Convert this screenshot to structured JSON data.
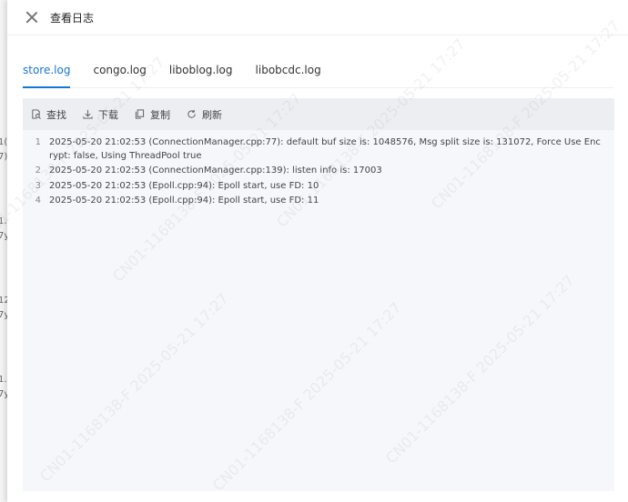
{
  "dialog": {
    "title": "查看日志"
  },
  "tabs": [
    {
      "label": "store.log",
      "active": true
    },
    {
      "label": "congo.log",
      "active": false
    },
    {
      "label": "liboblog.log",
      "active": false
    },
    {
      "label": "libobcdc.log",
      "active": false
    }
  ],
  "toolbar": {
    "find_label": "查找",
    "download_label": "下载",
    "copy_label": "复制",
    "refresh_label": "刷新"
  },
  "log": {
    "lines": [
      {
        "num": "1",
        "text": "2025-05-20 21:02:53 (ConnectionManager.cpp:77): default buf size is: 1048576, Msg split size is: 131072, Force Use Encrypt: false, Using ThreadPool true"
      },
      {
        "num": "2",
        "text": "2025-05-20 21:02:53 (ConnectionManager.cpp:139): listen info is: 17003"
      },
      {
        "num": "3",
        "text": "2025-05-20 21:02:53 (Epoll.cpp:94): Epoll start, use FD: 10"
      },
      {
        "num": "4",
        "text": "2025-05-20 21:02:53 (Epoll.cpp:94): Epoll start, use FD: 11"
      }
    ]
  },
  "watermark": {
    "text": "CN01-1168138-F 2025-05-21 17:27"
  },
  "background_fragments": [
    "1(",
    "7)",
    "1.",
    "7y",
    "12",
    "7y",
    "1.",
    "7y"
  ]
}
